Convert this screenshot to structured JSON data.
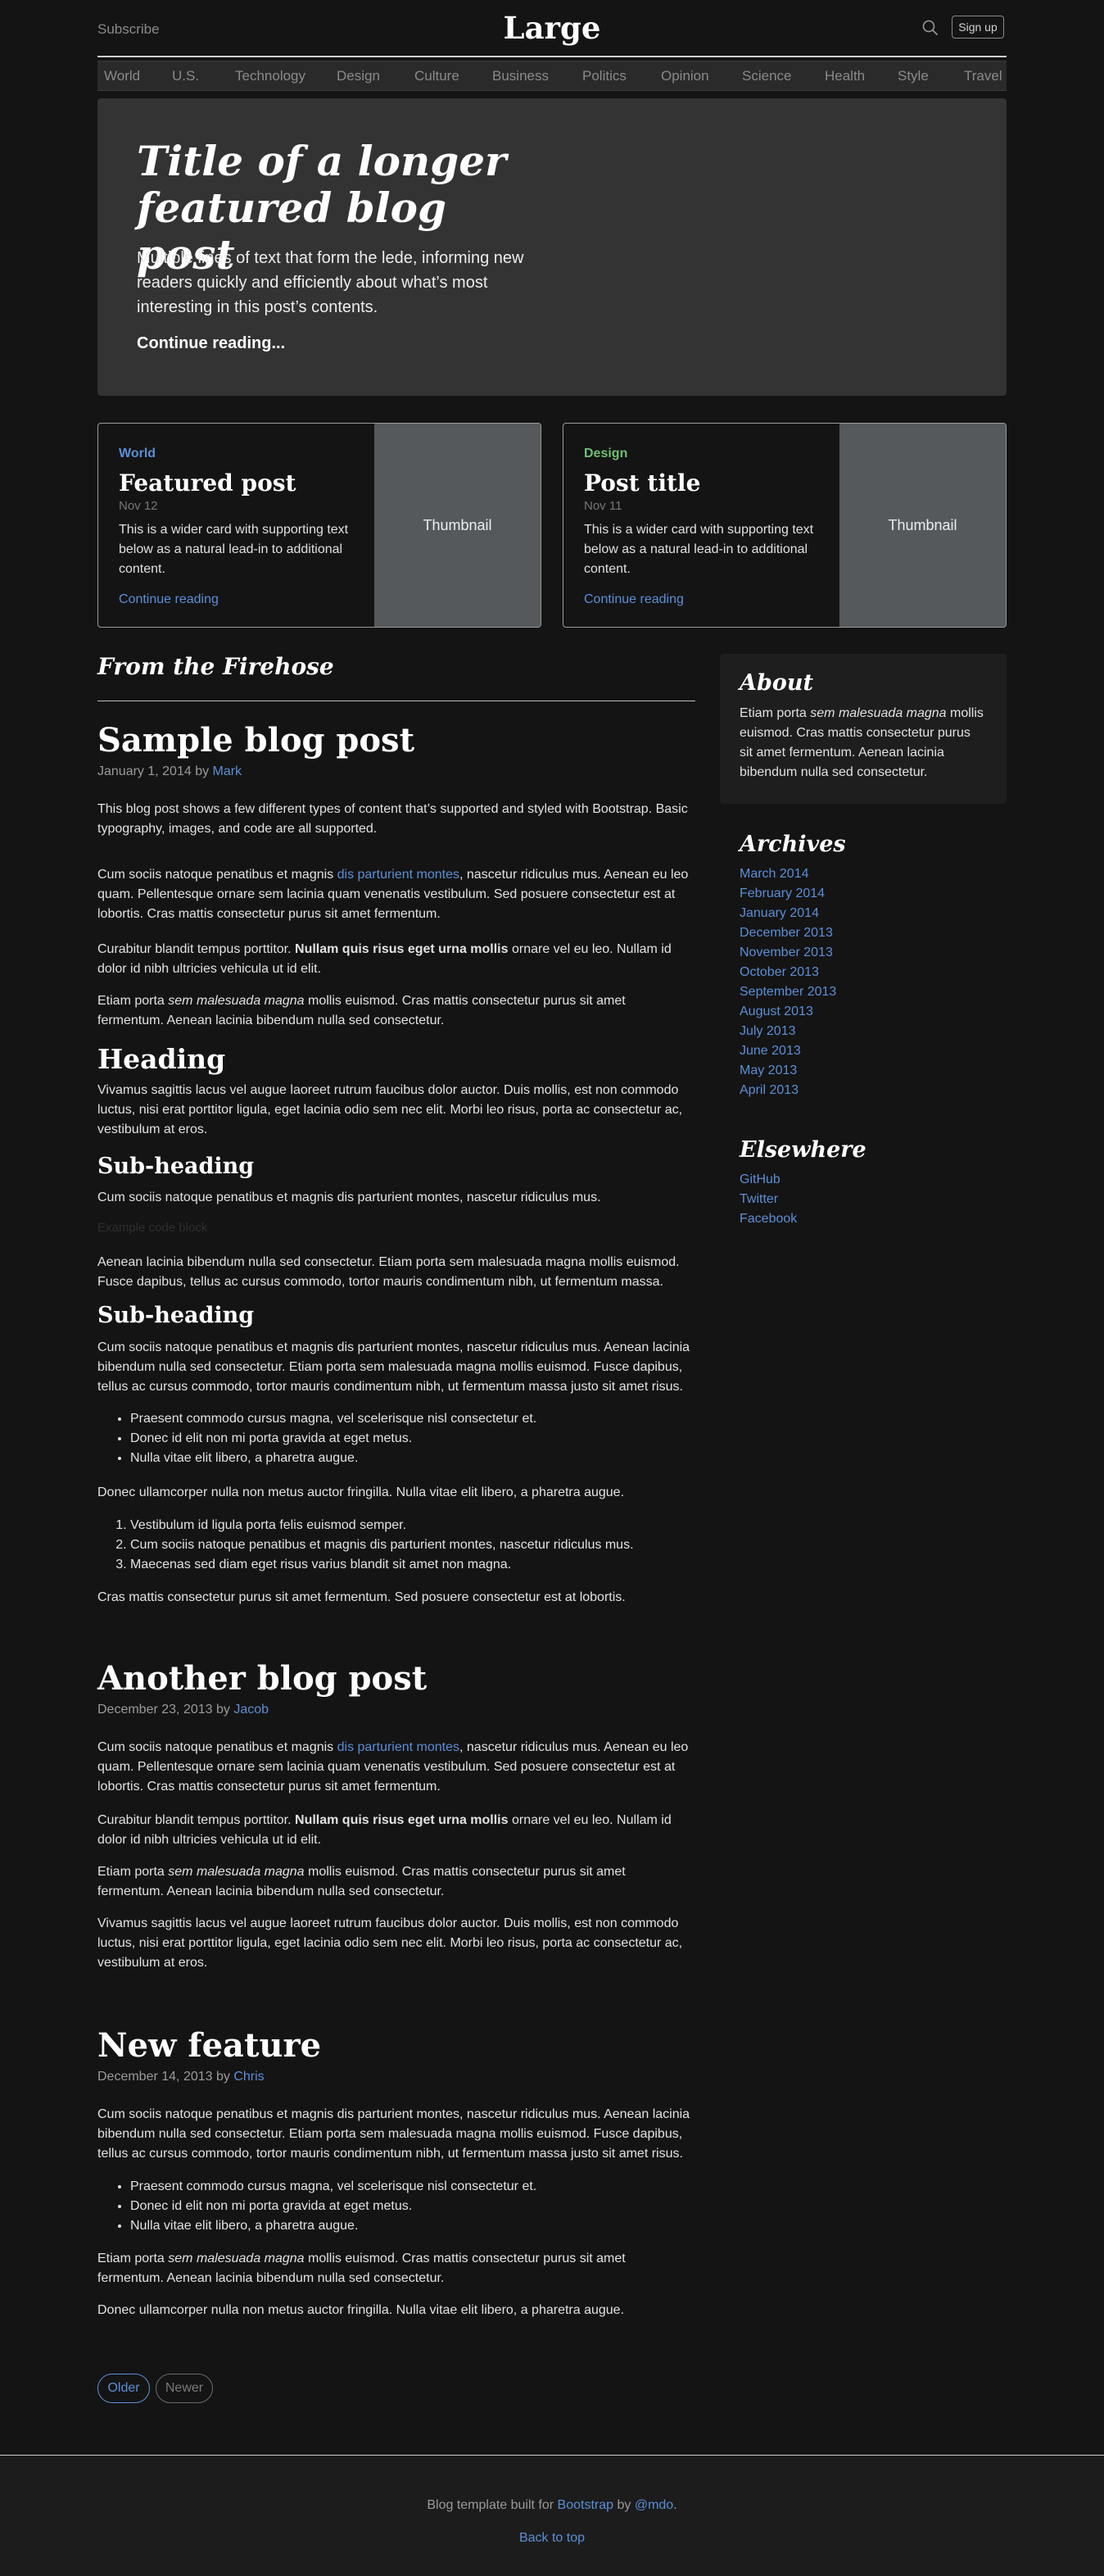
{
  "header": {
    "subscribe": "Subscribe",
    "brand": "Large",
    "signup": "Sign up"
  },
  "nav": [
    "World",
    "U.S.",
    "Technology",
    "Design",
    "Culture",
    "Business",
    "Politics",
    "Opinion",
    "Science",
    "Health",
    "Style",
    "Travel"
  ],
  "hero": {
    "title_line1": "Title of a longer",
    "title_line2": "featured blog post",
    "lede": "Multiple lines of text that form the lede, informing new readers quickly and efficiently about what’s most interesting in this post’s contents.",
    "continue": "Continue reading..."
  },
  "cards": [
    {
      "category": "World",
      "category_color": "#5b8fd6",
      "title": "Featured post",
      "date": "Nov 12",
      "text": "This is a wider card with supporting text below as a natural lead-in to additional content.",
      "link": "Continue reading",
      "thumb": "Thumbnail"
    },
    {
      "category": "Design",
      "category_color": "#6fbf73",
      "title": "Post title",
      "date": "Nov 11",
      "text": "This is a wider card with supporting text below as a natural lead-in to additional content.",
      "link": "Continue reading",
      "thumb": "Thumbnail"
    }
  ],
  "main": {
    "section_title": "From the Firehose",
    "post1": {
      "title": "Sample blog post",
      "meta_date": "January 1, 2014 by ",
      "meta_author": "Mark",
      "intro": "This blog post shows a few different types of content that’s supported and styled with Bootstrap. Basic typography, images, and code are all supported.",
      "p1_a": "Cum sociis natoque penatibus et magnis ",
      "p1_link": "dis parturient montes",
      "p1_b": ", nascetur ridiculus mus. Aenean eu leo quam. Pellentesque ornare sem lacinia quam venenatis vestibulum. Sed posuere consectetur est at lobortis. Cras mattis consectetur purus sit amet fermentum.",
      "p2_a": "Curabitur blandit tempus porttitor. ",
      "p2_bold": "Nullam quis risus eget urna mollis",
      "p2_b": " ornare vel eu leo. Nullam id dolor id nibh ultricies vehicula ut id elit.",
      "p3_a": "Etiam porta ",
      "p3_em": "sem malesuada magna",
      "p3_b": " mollis euismod. Cras mattis consectetur purus sit amet fermentum. Aenean lacinia bibendum nulla sed consectetur.",
      "heading": "Heading",
      "p4": "Vivamus sagittis lacus vel augue laoreet rutrum faucibus dolor auctor. Duis mollis, est non commodo luctus, nisi erat porttitor ligula, eget lacinia odio sem nec elit. Morbi leo risus, porta ac consectetur ac, vestibulum at eros.",
      "subheading1": "Sub-heading",
      "p5": "Cum sociis natoque penatibus et magnis dis parturient montes, nascetur ridiculus mus.",
      "code": "Example code block",
      "p6": "Aenean lacinia bibendum nulla sed consectetur. Etiam porta sem malesuada magna mollis euismod. Fusce dapibus, tellus ac cursus commodo, tortor mauris condimentum nibh, ut fermentum massa.",
      "subheading2": "Sub-heading",
      "p7": "Cum sociis natoque penatibus et magnis dis parturient montes, nascetur ridiculus mus. Aenean lacinia bibendum nulla sed consectetur. Etiam porta sem malesuada magna mollis euismod. Fusce dapibus, tellus ac cursus commodo, tortor mauris condimentum nibh, ut fermentum massa justo sit amet risus.",
      "ul": [
        "Praesent commodo cursus magna, vel scelerisque nisl consectetur et.",
        "Donec id elit non mi porta gravida at eget metus.",
        "Nulla vitae elit libero, a pharetra augue."
      ],
      "p8": "Donec ullamcorper nulla non metus auctor fringilla. Nulla vitae elit libero, a pharetra augue.",
      "ol": [
        "Vestibulum id ligula porta felis euismod semper.",
        "Cum sociis natoque penatibus et magnis dis parturient montes, nascetur ridiculus mus.",
        "Maecenas sed diam eget risus varius blandit sit amet non magna."
      ],
      "p9": "Cras mattis consectetur purus sit amet fermentum. Sed posuere consectetur est at lobortis."
    },
    "post2": {
      "title": "Another blog post",
      "meta_date": "December 23, 2013 by ",
      "meta_author": "Jacob",
      "p1_a": "Cum sociis natoque penatibus et magnis ",
      "p1_link": "dis parturient montes",
      "p1_b": ", nascetur ridiculus mus. Aenean eu leo quam. Pellentesque ornare sem lacinia quam venenatis vestibulum. Sed posuere consectetur est at lobortis. Cras mattis consectetur purus sit amet fermentum.",
      "p2_a": "Curabitur blandit tempus porttitor. ",
      "p2_bold": "Nullam quis risus eget urna mollis",
      "p2_b": " ornare vel eu leo. Nullam id dolor id nibh ultricies vehicula ut id elit.",
      "p3_a": "Etiam porta ",
      "p3_em": "sem malesuada magna",
      "p3_b": " mollis euismod. Cras mattis consectetur purus sit amet fermentum. Aenean lacinia bibendum nulla sed consectetur.",
      "p4": "Vivamus sagittis lacus vel augue laoreet rutrum faucibus dolor auctor. Duis mollis, est non commodo luctus, nisi erat porttitor ligula, eget lacinia odio sem nec elit. Morbi leo risus, porta ac consectetur ac, vestibulum at eros."
    },
    "post3": {
      "title": "New feature",
      "meta_date": "December 14, 2013 by ",
      "meta_author": "Chris",
      "p1": "Cum sociis natoque penatibus et magnis dis parturient montes, nascetur ridiculus mus. Aenean lacinia bibendum nulla sed consectetur. Etiam porta sem malesuada magna mollis euismod. Fusce dapibus, tellus ac cursus commodo, tortor mauris condimentum nibh, ut fermentum massa justo sit amet risus.",
      "ul": [
        "Praesent commodo cursus magna, vel scelerisque nisl consectetur et.",
        "Donec id elit non mi porta gravida at eget metus.",
        "Nulla vitae elit libero, a pharetra augue."
      ],
      "p2_a": "Etiam porta ",
      "p2_em": "sem malesuada magna",
      "p2_b": " mollis euismod. Cras mattis consectetur purus sit amet fermentum. Aenean lacinia bibendum nulla sed consectetur.",
      "p3": "Donec ullamcorper nulla non metus auctor fringilla. Nulla vitae elit libero, a pharetra augue."
    },
    "pagination": {
      "older": "Older",
      "newer": "Newer"
    }
  },
  "sidebar": {
    "about_title": "About",
    "about_a": "Etiam porta ",
    "about_em": "sem malesuada magna",
    "about_b": " mollis euismod. Cras mattis consectetur purus sit amet fermentum. Aenean lacinia bibendum nulla sed consectetur.",
    "archives_title": "Archives",
    "archives": [
      "March 2014",
      "February 2014",
      "January 2014",
      "December 2013",
      "November 2013",
      "October 2013",
      "September 2013",
      "August 2013",
      "July 2013",
      "June 2013",
      "May 2013",
      "April 2013"
    ],
    "elsewhere_title": "Elsewhere",
    "elsewhere": [
      "GitHub",
      "Twitter",
      "Facebook"
    ]
  },
  "footer": {
    "text_a": "Blog template built for ",
    "link1": "Bootstrap",
    "text_b": " by ",
    "link2": "@mdo",
    "text_c": ".",
    "back_top": "Back to top"
  },
  "colors": {
    "link": "#5b8fd6",
    "background": "#141414",
    "hero": "#333333",
    "thumbnail": "#55595c"
  }
}
